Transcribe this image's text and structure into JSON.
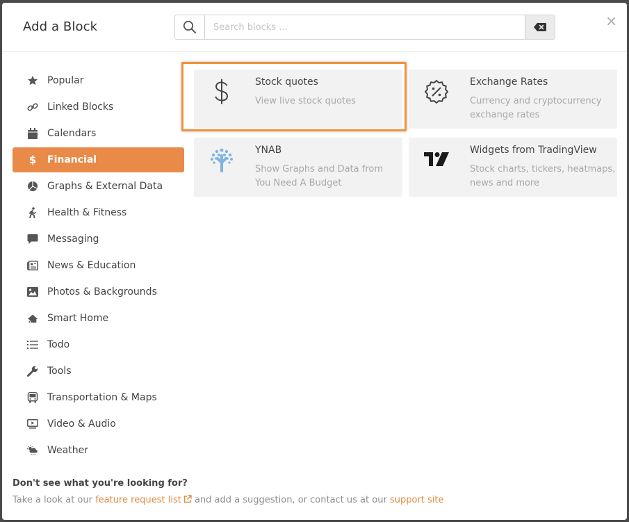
{
  "modal": {
    "title": "Add a Block",
    "search": {
      "placeholder": "Search blocks ...",
      "value": ""
    },
    "close_label": "×"
  },
  "sidebar": {
    "items": [
      {
        "label": "Popular",
        "icon": "star-icon"
      },
      {
        "label": "Linked Blocks",
        "icon": "link-icon"
      },
      {
        "label": "Calendars",
        "icon": "calendar-icon"
      },
      {
        "label": "Financial",
        "icon": "dollar-icon",
        "active": true
      },
      {
        "label": "Graphs & External Data",
        "icon": "chart-pie-icon"
      },
      {
        "label": "Health & Fitness",
        "icon": "walking-icon"
      },
      {
        "label": "Messaging",
        "icon": "comment-icon"
      },
      {
        "label": "News & Education",
        "icon": "newspaper-icon"
      },
      {
        "label": "Photos & Backgrounds",
        "icon": "image-icon"
      },
      {
        "label": "Smart Home",
        "icon": "smart-home-icon"
      },
      {
        "label": "Todo",
        "icon": "list-icon"
      },
      {
        "label": "Tools",
        "icon": "wrench-icon"
      },
      {
        "label": "Transportation & Maps",
        "icon": "bus-icon"
      },
      {
        "label": "Video & Audio",
        "icon": "video-icon"
      },
      {
        "label": "Weather",
        "icon": "cloud-sun-icon"
      }
    ]
  },
  "cards": [
    {
      "title": "Stock quotes",
      "desc": "View live stock quotes",
      "icon": "dollar-sign-icon"
    },
    {
      "title": "Exchange Rates",
      "desc": "Currency and cryptocurrency exchange rates",
      "icon": "percent-badge-icon"
    },
    {
      "title": "YNAB",
      "desc": "Show Graphs and Data from You Need A Budget",
      "icon": "ynab-tree-icon"
    },
    {
      "title": "Widgets from TradingView",
      "desc": "Stock charts, tickers, heatmaps, news and more",
      "icon": "tradingview-logo-icon"
    }
  ],
  "footer": {
    "question": "Don't see what you're looking for?",
    "text1": "Take a look at our ",
    "link1": "feature request list",
    "text2": " and add a suggestion, or contact us at our ",
    "link2": "support site"
  },
  "colors": {
    "accent": "#ea8a48",
    "highlight": "#f0923e",
    "card_bg": "#f2f2f2"
  }
}
